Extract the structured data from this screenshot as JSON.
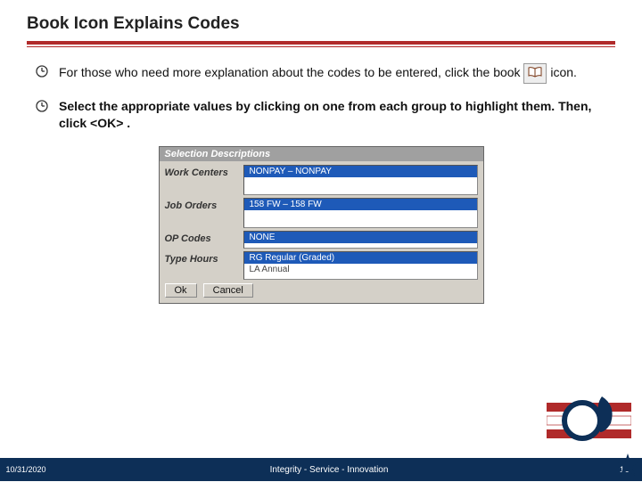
{
  "title": "Book Icon Explains Codes",
  "bullets": {
    "b1_pre": "For those who need more explanation about the codes to be entered, click the book ",
    "b1_post": " icon.",
    "b2": "Select the appropriate values by clicking on one from each group to highlight them. Then, click <OK> ."
  },
  "dialog": {
    "title": "Selection Descriptions",
    "fields": {
      "work_centers": {
        "label": "Work Centers",
        "value": "NONPAY – NONPAY"
      },
      "job_orders": {
        "label": "Job Orders",
        "value": "158 FW – 158 FW"
      },
      "op_codes": {
        "label": "OP Codes",
        "value": "NONE"
      },
      "type_hours": {
        "label": "Type Hours",
        "sel": "RG   Regular (Graded)",
        "other": "LA   Annual"
      }
    },
    "buttons": {
      "ok": "Ok",
      "cancel": "Cancel"
    }
  },
  "footer": {
    "date": "10/31/2020",
    "tagline": "Integrity - Service - Innovation",
    "pagenum": "12"
  }
}
